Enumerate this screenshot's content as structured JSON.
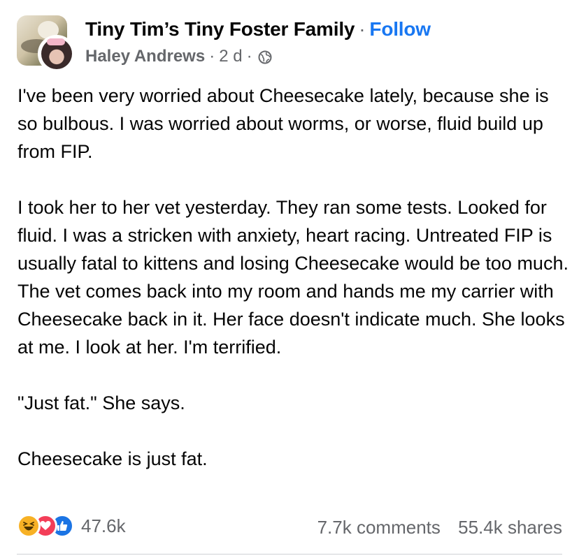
{
  "post": {
    "group_name": "Tiny Tim’s Tiny Foster Family",
    "follow_label": "Follow",
    "author": "Haley Andrews",
    "time_ago": "2 d",
    "privacy_icon": "globe-icon",
    "separator": "·",
    "paragraphs": [
      "I've been very worried about Cheesecake lately, because she is so bulbous. I was worried about worms, or worse, fluid build up from FIP.",
      "I took her to her vet yesterday. They ran some tests. Looked for fluid. I was a stricken with anxiety, heart racing. Untreated FIP is usually fatal to kittens and losing Cheesecake would be too much. The vet comes back into my room and hands me my carrier with Cheesecake back in it. Her face doesn't indicate much. She looks at me. I look at her. I'm terrified.",
      "\"Just fat.\" She says.",
      "Cheesecake is just fat."
    ]
  },
  "footer": {
    "reaction_icons": [
      "haha-icon",
      "love-icon",
      "like-icon"
    ],
    "reaction_count": "47.6k",
    "comments": "7.7k comments",
    "shares": "55.4k shares"
  },
  "colors": {
    "link_blue": "#1877f2",
    "secondary_text": "#65676b",
    "haha": "#f7b125",
    "love": "#f33e58",
    "like": "#1b74e4"
  }
}
